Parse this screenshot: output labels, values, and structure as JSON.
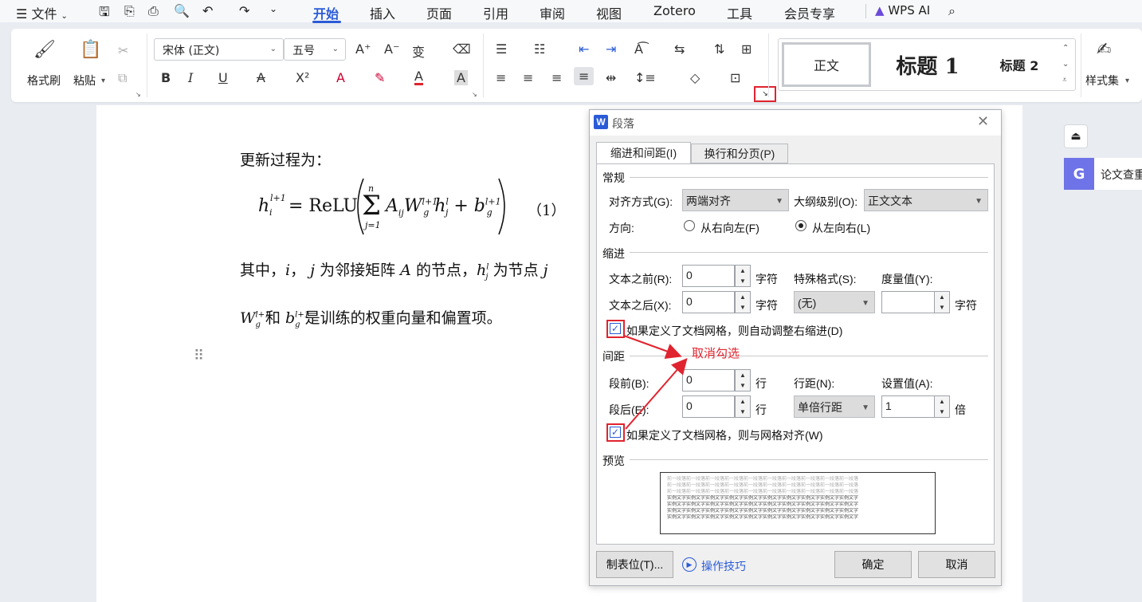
{
  "menu": {
    "file": "文件",
    "tabs": [
      "开始",
      "插入",
      "页面",
      "引用",
      "审阅",
      "视图",
      "Zotero",
      "工具",
      "会员专享"
    ],
    "wps_ai": "WPS AI"
  },
  "ribbon": {
    "format_painter": "格式刷",
    "paste": "粘贴",
    "font_name": "宋体 (正文)",
    "font_size": "五号",
    "styles": {
      "normal": "正文",
      "h1": "标题 1",
      "h2": "标题 2"
    },
    "style_set": "样式集"
  },
  "document": {
    "line1": "更新过程为：",
    "eq_number": "（1）",
    "line2_prefix": "其中，",
    "line2_mid": "为邻接矩阵",
    "line2_mid2": "的节点，",
    "line2_end": "为节点",
    "line3_and": "和",
    "line3_end": "是训练的权重向量和偏置项。"
  },
  "sidepanel": {
    "paper_check": "论文查重"
  },
  "dialog": {
    "title": "段落",
    "tabs": [
      "缩进和间距(I)",
      "换行和分页(P)"
    ],
    "general": {
      "heading": "常规",
      "align_label": "对齐方式(G):",
      "align_value": "两端对齐",
      "outline_label": "大纲级别(O):",
      "outline_value": "正文文本",
      "direction_label": "方向:",
      "rtl": "从右向左(F)",
      "ltr": "从左向右(L)"
    },
    "indent": {
      "heading": "缩进",
      "before_label": "文本之前(R):",
      "before_value": "0",
      "before_unit": "字符",
      "after_label": "文本之后(X):",
      "after_value": "0",
      "after_unit": "字符",
      "special_label": "特殊格式(S):",
      "special_value": "(无)",
      "measure_label": "度量值(Y):",
      "measure_value": "",
      "measure_unit": "字符",
      "auto_adjust": "如果定义了文档网格，则自动调整右缩进(D)"
    },
    "spacing": {
      "heading": "间距",
      "before_label": "段前(B):",
      "before_value": "0",
      "before_unit": "行",
      "after_label": "段后(E):",
      "after_value": "0",
      "after_unit": "行",
      "line_label": "行距(N):",
      "line_value": "单倍行距",
      "set_label": "设置值(A):",
      "set_value": "1",
      "set_unit": "倍",
      "snap_grid": "如果定义了文档网格，则与网格对齐(W)"
    },
    "preview": {
      "heading": "预览",
      "prev": "前一段落前一段落前一段落前一段落前一段落前一段落前一段落前一段落前一段落前一段落",
      "sample": "实例文字实例文字实例文字实例文字实例文字实例文字实例文字实例文字实例文字实例文字"
    },
    "buttons": {
      "tabs": "制表位(T)...",
      "tips": "操作技巧",
      "ok": "确定",
      "cancel": "取消"
    }
  },
  "annotation": {
    "text": "取消勾选",
    "color": "#e0242f"
  }
}
